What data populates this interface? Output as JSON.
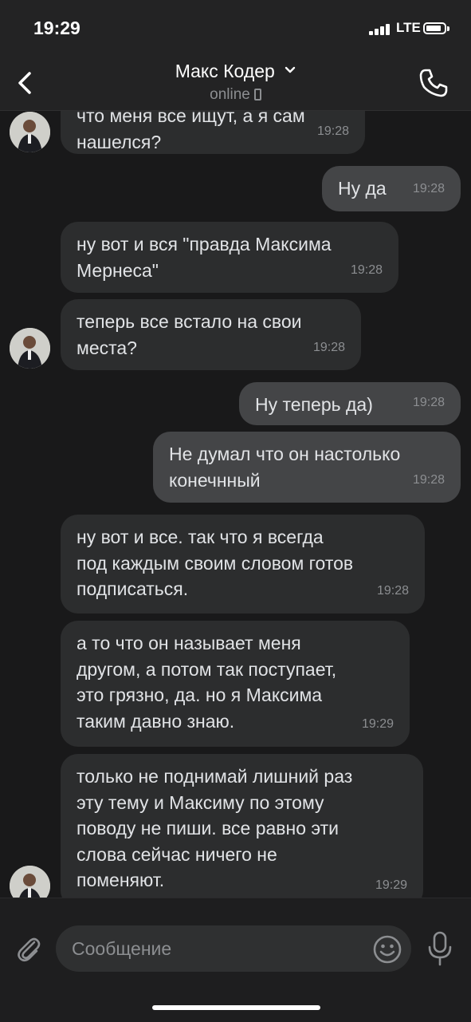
{
  "status_bar": {
    "time": "19:29",
    "network": "LTE"
  },
  "header": {
    "contact_name": "Макс Кодер",
    "status": "online"
  },
  "messages": [
    {
      "direction": "incoming",
      "text": "что меня все ищут, а я сам\nнашелся?",
      "time": "19:28"
    },
    {
      "direction": "outgoing",
      "text": "Ну да",
      "time": "19:28"
    },
    {
      "direction": "incoming",
      "text": "ну вот и вся \"правда Максима\nМернеса\"",
      "time": "19:28"
    },
    {
      "direction": "incoming",
      "text": "теперь все встало на свои\nместа?",
      "time": "19:28"
    },
    {
      "direction": "outgoing",
      "text": "Ну теперь да)",
      "time": "19:28"
    },
    {
      "direction": "outgoing",
      "text": "Не думал что он настолько\nконечнный",
      "time": "19:28"
    },
    {
      "direction": "incoming",
      "text": "ну вот и все. так что я всегда\nпод каждым своим словом готов\nподписаться.",
      "time": "19:28"
    },
    {
      "direction": "incoming",
      "text": "а то что он называет меня\nдругом, а потом так поступает,\nэто грязно, да. но я Максима\nтаким давно знаю.",
      "time": "19:29"
    },
    {
      "direction": "incoming",
      "text": "только не поднимай лишний раз\nэту тему и Максиму по этому\nповоду не пиши. все равно эти\nслова сейчас ничего не\nпоменяют.",
      "time": "19:29"
    }
  ],
  "composer": {
    "placeholder": "Сообщение"
  },
  "colors": {
    "background": "#19191a",
    "incoming_bubble": "#2c2d2e",
    "outgoing_bubble": "#444547",
    "text": "#e1e3e6",
    "muted": "#8c8e91"
  },
  "icons": [
    "back-icon",
    "chevron-down-icon",
    "call-icon",
    "attach-icon",
    "emoji-icon",
    "microphone-icon"
  ]
}
